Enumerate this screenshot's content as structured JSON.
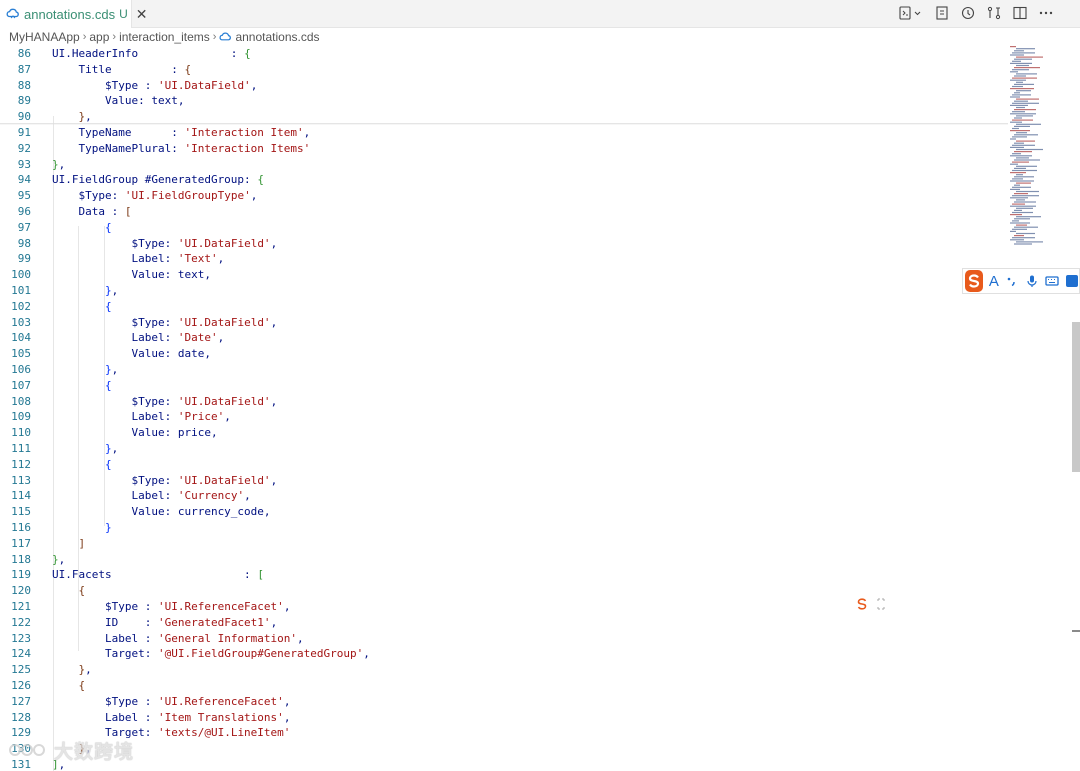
{
  "tab": {
    "filename": "annotations.cds",
    "status": "U"
  },
  "breadcrumb": [
    "MyHANAApp",
    "app",
    "interaction_items",
    "annotations.cds"
  ],
  "code_lines": [
    {
      "n": "86",
      "t": "UI.HeaderInfo              : {"
    },
    {
      "n": "87",
      "t": "    Title         : {"
    },
    {
      "n": "88",
      "t": "        $Type : 'UI.DataField',"
    },
    {
      "n": "89",
      "t": "        Value: text,"
    },
    {
      "n": "90",
      "t": "    },"
    },
    {
      "n": "91",
      "t": "    TypeName      : 'Interaction Item',"
    },
    {
      "n": "92",
      "t": "    TypeNamePlural: 'Interaction Items'"
    },
    {
      "n": "93",
      "t": "},"
    },
    {
      "n": "94",
      "t": "UI.FieldGroup #GeneratedGroup: {"
    },
    {
      "n": "95",
      "t": "    $Type: 'UI.FieldGroupType',"
    },
    {
      "n": "96",
      "t": "    Data : ["
    },
    {
      "n": "97",
      "t": "        {"
    },
    {
      "n": "98",
      "t": "            $Type: 'UI.DataField',"
    },
    {
      "n": "99",
      "t": "            Label: 'Text',"
    },
    {
      "n": "100",
      "t": "            Value: text,"
    },
    {
      "n": "101",
      "t": "        },"
    },
    {
      "n": "102",
      "t": "        {"
    },
    {
      "n": "103",
      "t": "            $Type: 'UI.DataField',"
    },
    {
      "n": "104",
      "t": "            Label: 'Date',"
    },
    {
      "n": "105",
      "t": "            Value: date,"
    },
    {
      "n": "106",
      "t": "        },"
    },
    {
      "n": "107",
      "t": "        {"
    },
    {
      "n": "108",
      "t": "            $Type: 'UI.DataField',"
    },
    {
      "n": "109",
      "t": "            Label: 'Price',"
    },
    {
      "n": "110",
      "t": "            Value: price,"
    },
    {
      "n": "111",
      "t": "        },"
    },
    {
      "n": "112",
      "t": "        {"
    },
    {
      "n": "113",
      "t": "            $Type: 'UI.DataField',"
    },
    {
      "n": "114",
      "t": "            Label: 'Currency',"
    },
    {
      "n": "115",
      "t": "            Value: currency_code,"
    },
    {
      "n": "116",
      "t": "        }"
    },
    {
      "n": "117",
      "t": "    ]"
    },
    {
      "n": "118",
      "t": "},"
    },
    {
      "n": "119",
      "t": "UI.Facets                    : ["
    },
    {
      "n": "120",
      "t": "    {"
    },
    {
      "n": "121",
      "t": "        $Type : 'UI.ReferenceFacet',"
    },
    {
      "n": "122",
      "t": "        ID    : 'GeneratedFacet1',"
    },
    {
      "n": "123",
      "t": "        Label : 'General Information',"
    },
    {
      "n": "124",
      "t": "        Target: '@UI.FieldGroup#GeneratedGroup',"
    },
    {
      "n": "125",
      "t": "    },"
    },
    {
      "n": "126",
      "t": "    {"
    },
    {
      "n": "127",
      "t": "        $Type : 'UI.ReferenceFacet',"
    },
    {
      "n": "128",
      "t": "        Label : 'Item Translations',"
    },
    {
      "n": "129",
      "t": "        Target: 'texts/@UI.LineItem'"
    },
    {
      "n": "130",
      "t": "    },"
    },
    {
      "n": "131",
      "t": "],"
    }
  ],
  "watermark": "大数跨境",
  "colors": {
    "line_number": "#237893",
    "property": "#001080",
    "string": "#a31515",
    "brace_outer": "#319331",
    "brace_mid": "#7b3814",
    "brace_inner": "#0431fa",
    "tab_modified": "#3a8f74",
    "ime_orange": "#e85a1c"
  }
}
